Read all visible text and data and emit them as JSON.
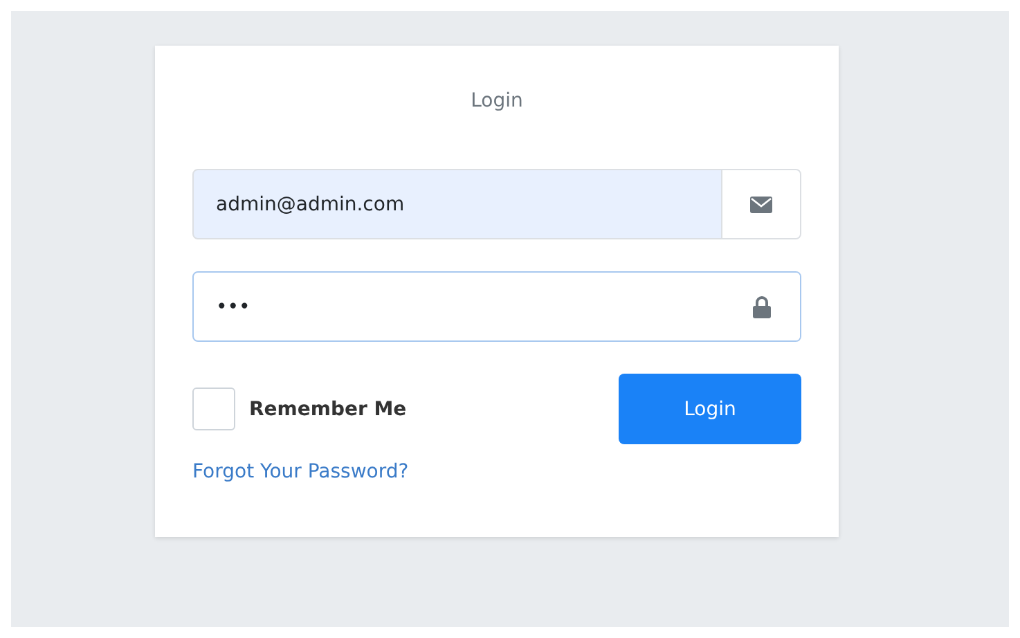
{
  "card": {
    "title": "Login"
  },
  "email_field": {
    "value": "admin@admin.com"
  },
  "password_field": {
    "value": "•••"
  },
  "remember_me": {
    "label": "Remember Me",
    "checked": false
  },
  "login_button": {
    "label": "Login"
  },
  "forgot_link": {
    "label": "Forgot Your Password?"
  }
}
